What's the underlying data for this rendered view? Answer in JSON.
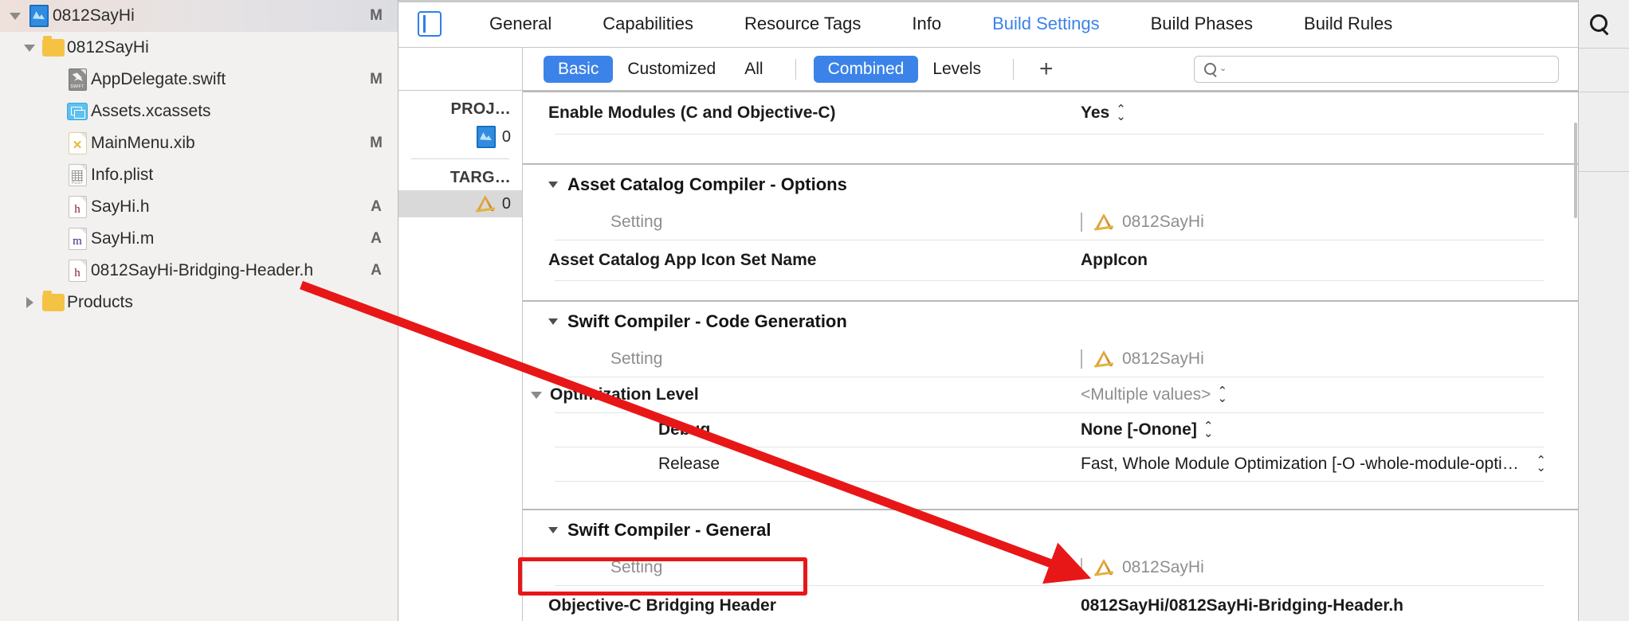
{
  "navigator": {
    "items": [
      {
        "label": "0812SayHi",
        "status": "M",
        "icon": "xcodeproj-icon",
        "disclosure": "down",
        "indent": 0,
        "selected": true
      },
      {
        "label": "0812SayHi",
        "status": "",
        "icon": "folder-icon",
        "disclosure": "down",
        "indent": 1,
        "selected": false
      },
      {
        "label": "AppDelegate.swift",
        "status": "M",
        "icon": "swift-file-icon",
        "disclosure": "",
        "indent": 2,
        "selected": false
      },
      {
        "label": "Assets.xcassets",
        "status": "",
        "icon": "xcassets-icon",
        "disclosure": "",
        "indent": 2,
        "selected": false
      },
      {
        "label": "MainMenu.xib",
        "status": "M",
        "icon": "xib-file-icon",
        "disclosure": "",
        "indent": 2,
        "selected": false
      },
      {
        "label": "Info.plist",
        "status": "",
        "icon": "plist-file-icon",
        "disclosure": "",
        "indent": 2,
        "selected": false
      },
      {
        "label": "SayHi.h",
        "status": "A",
        "icon": "header-file-icon",
        "disclosure": "",
        "indent": 2,
        "selected": false
      },
      {
        "label": "SayHi.m",
        "status": "A",
        "icon": "objc-file-icon",
        "disclosure": "",
        "indent": 2,
        "selected": false
      },
      {
        "label": "0812SayHi-Bridging-Header.h",
        "status": "A",
        "icon": "header-file-icon",
        "disclosure": "",
        "indent": 2,
        "selected": false
      },
      {
        "label": "Products",
        "status": "",
        "icon": "folder-icon",
        "disclosure": "right",
        "indent": 1,
        "selected": false
      }
    ]
  },
  "tabbar": {
    "project_button_icon": "project-navigator-icon",
    "tabs": [
      {
        "label": "General",
        "active": false
      },
      {
        "label": "Capabilities",
        "active": false
      },
      {
        "label": "Resource Tags",
        "active": false
      },
      {
        "label": "Info",
        "active": false
      },
      {
        "label": "Build Settings",
        "active": true
      },
      {
        "label": "Build Phases",
        "active": false
      },
      {
        "label": "Build Rules",
        "active": false
      }
    ],
    "active_color": "#3b83e8"
  },
  "filterbar": {
    "scope": [
      {
        "label": "Basic",
        "on": true
      },
      {
        "label": "Customized",
        "on": false
      },
      {
        "label": "All",
        "on": false
      }
    ],
    "view": [
      {
        "label": "Combined",
        "on": true
      },
      {
        "label": "Levels",
        "on": false
      }
    ],
    "add_label": "+",
    "search": {
      "value": "",
      "placeholder": "",
      "icon": "search-icon"
    }
  },
  "sidepanel": {
    "project_header": "PROJ…",
    "project_item": "0",
    "targets_header": "TARG…",
    "target_item": "0"
  },
  "settings": {
    "rows": [
      {
        "kind": "setting",
        "name": "Enable Modules (C and Objective-C)",
        "value": "Yes",
        "stepper": true,
        "bold": true
      },
      {
        "kind": "group",
        "name": "Asset Catalog Compiler - Options"
      },
      {
        "kind": "header",
        "name": "Setting",
        "value": "0812SayHi"
      },
      {
        "kind": "setting",
        "name": "Asset Catalog App Icon Set Name",
        "value": "AppIcon",
        "stepper": false,
        "bold": true
      },
      {
        "kind": "group",
        "name": "Swift Compiler - Code Generation"
      },
      {
        "kind": "header",
        "name": "Setting",
        "value": "0812SayHi"
      },
      {
        "kind": "setting-group",
        "name": "Optimization Level",
        "value": "<Multiple values>",
        "stepper": true,
        "muted": true
      },
      {
        "kind": "sub-bold",
        "name": "Debug",
        "value": "None [-Onone]",
        "stepper": true
      },
      {
        "kind": "sub",
        "name": "Release",
        "value": "Fast, Whole Module Optimization  [-O -whole-module-opti…",
        "stepper": true
      },
      {
        "kind": "group",
        "name": "Swift Compiler - General"
      },
      {
        "kind": "header",
        "name": "Setting",
        "value": "0812SayHi"
      },
      {
        "kind": "setting",
        "name": "Objective-C Bridging Header",
        "value": "0812SayHi/0812SayHi-Bridging-Header.h",
        "stepper": false,
        "bold": true,
        "highlight": true
      }
    ]
  },
  "annotations": {
    "arrow_color": "#e81717",
    "highlight_color": "#e81717",
    "arrow_from": "0812SayHi-Bridging-Header.h",
    "arrow_to": "0812SayHi/0812SayHi-Bridging-Header.h"
  }
}
